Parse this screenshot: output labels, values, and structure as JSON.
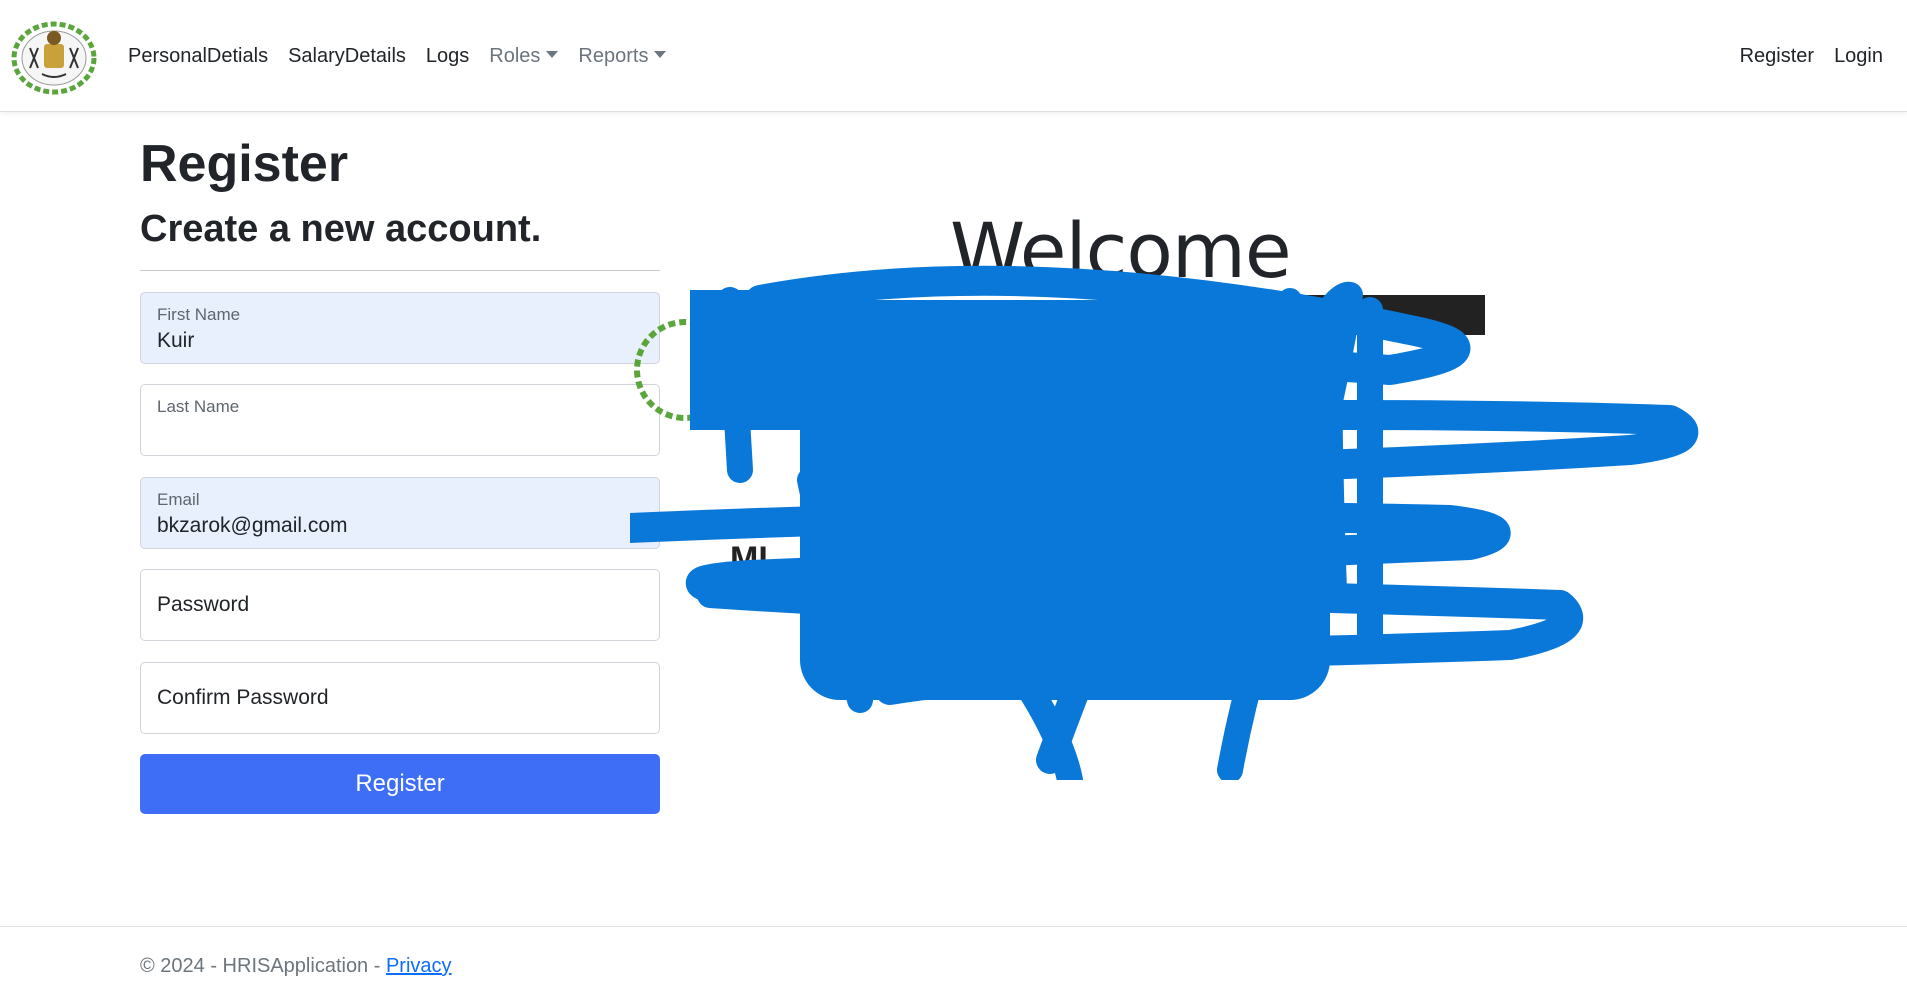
{
  "nav": {
    "items": [
      {
        "label": "PersonalDetials"
      },
      {
        "label": "SalaryDetails"
      },
      {
        "label": "Logs"
      },
      {
        "label": "Roles"
      },
      {
        "label": "Reports"
      }
    ],
    "register_label": "Register",
    "login_label": "Login"
  },
  "form": {
    "title": "Register",
    "subtitle": "Create a new account.",
    "first_name": {
      "label": "First Name",
      "value": "Kuir"
    },
    "last_name": {
      "label": "Last Name",
      "value": ""
    },
    "email": {
      "label": "Email",
      "value": "bkzarok@gmail.com"
    },
    "password": {
      "label": "Password"
    },
    "confirm_password": {
      "label": "Confirm Password"
    },
    "submit_label": "Register"
  },
  "welcome": {
    "heading": "Welcome"
  },
  "footer": {
    "text": "© 2024 - HRISApplication - ",
    "privacy_label": "Privacy"
  },
  "colors": {
    "primary_button": "#3d6ef5",
    "autofill_bg": "#e8f0fe",
    "redaction_scribble": "#0a78d8",
    "link": "#0d6efd"
  },
  "icons": {
    "brand": "emblem-logo-icon"
  }
}
